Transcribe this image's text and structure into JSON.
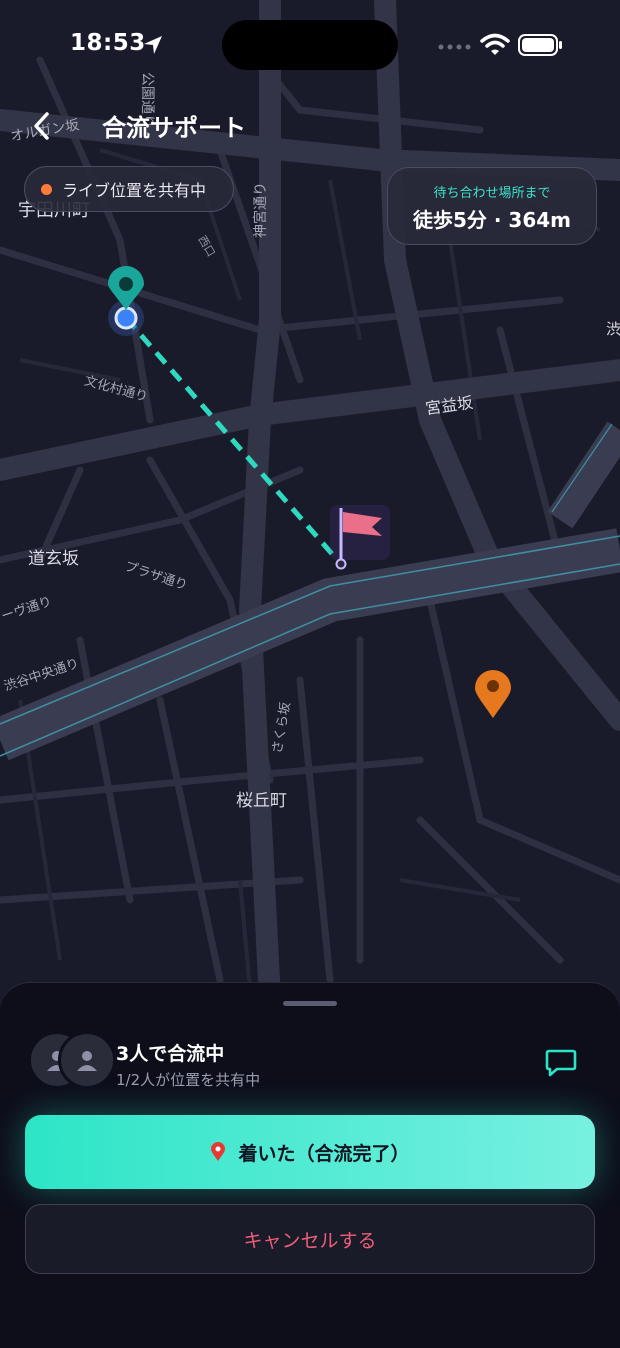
{
  "status": {
    "time": "18:53"
  },
  "header": {
    "title": "合流サポート"
  },
  "live_pill": {
    "label": "ライブ位置を共有中"
  },
  "eta": {
    "label": "待ち合わせ場所まで",
    "value": "徒歩5分 · 364m"
  },
  "map_labels": {
    "udagawa": "宇田川町",
    "olgan": "オルガン坂",
    "koen": "公園通り",
    "jingu": "神宮通り",
    "bunka": "文化村通り",
    "miyamasu": "宮益坂",
    "dogen": "道玄坂",
    "plaza": "プラザ通り",
    "vue": "ーヴ通り",
    "chuo": "渋谷中央通り",
    "sakurazaka": "さくら坂",
    "sakuragaoka": "桜丘町",
    "shibu": "渋",
    "kuchi": "西口"
  },
  "sheet": {
    "group_title": "3人で合流中",
    "group_sub": "1/2人が位置を共有中",
    "arrive_label": "着いた（合流完了）",
    "cancel_label": "キャンセルする"
  },
  "colors": {
    "accent": "#2de5c6",
    "live_dot": "#ff7b3a",
    "cancel": "#ee5e78",
    "orange_pin": "#e6781e"
  }
}
